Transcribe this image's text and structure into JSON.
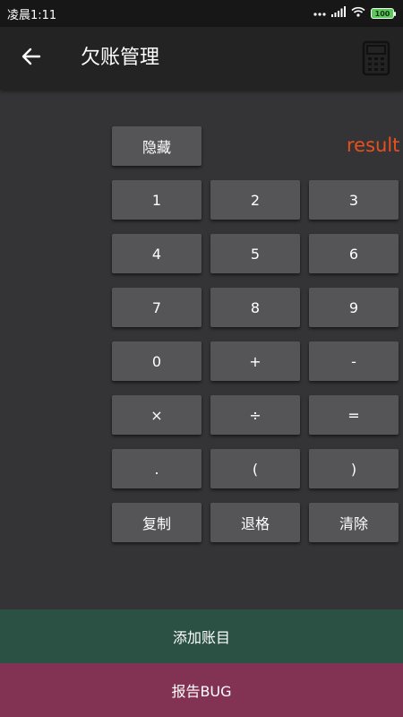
{
  "status_bar": {
    "time": "凌晨1:11",
    "battery": "100"
  },
  "app_bar": {
    "title": "欠账管理",
    "back_icon": "arrow-left-icon",
    "action_icon": "calculator-icon"
  },
  "calculator": {
    "hide_label": "隐藏",
    "result": "result",
    "keys": [
      "1",
      "2",
      "3",
      "4",
      "5",
      "6",
      "7",
      "8",
      "9",
      "0",
      "+",
      "-",
      "×",
      "÷",
      "=",
      ".",
      "(",
      ")",
      "复制",
      "退格",
      "清除"
    ]
  },
  "buttons": {
    "add_account": "添加账目",
    "report_bug": "报告BUG"
  },
  "colors": {
    "background": "#343436",
    "app_bar": "#232324",
    "key": "#555557",
    "result": "#e8501c",
    "add_button": "#2b5144",
    "bug_button": "#823353"
  }
}
